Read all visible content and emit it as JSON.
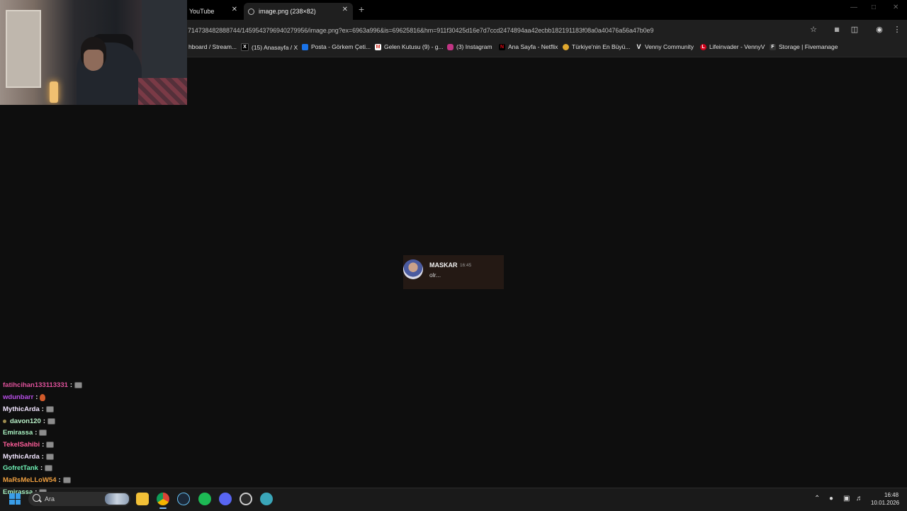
{
  "browser": {
    "tabs": [
      {
        "label": "YouTube"
      },
      {
        "label": "image.png (238×82)"
      }
    ],
    "new_tab_symbol": "+",
    "close_symbol": "✕",
    "url": "714738482888744/1459543796940279956/image.png?ex=6963a996&is=69625816&hm=911f30425d16e7d7ccd2474894aa42ecbb182191183f08a0a40476a56a47b0e9",
    "bookmarks": [
      {
        "label": "hboard / Stream...",
        "icon": "stream-icon",
        "color": "#1f1f1f"
      },
      {
        "label": "(15) Anasayfa / X",
        "icon": "x-icon",
        "color": "#000000"
      },
      {
        "label": "Posta - Görkem Çeti...",
        "icon": "outlook-icon",
        "color": "#1a73e8"
      },
      {
        "label": "Gelen Kutusu (9) - g...",
        "icon": "gmail-icon",
        "color": "#d93025"
      },
      {
        "label": "(3) Instagram",
        "icon": "instagram-icon",
        "color": "#c13584"
      },
      {
        "label": "Ana Sayfa - Netflix",
        "icon": "netflix-icon",
        "color": "#e50914"
      },
      {
        "label": "Türkiye'nin En Büyü...",
        "icon": "site-icon",
        "color": "#e0a82e"
      },
      {
        "label": "Venny Community",
        "icon": "venny-icon",
        "color": "#444444"
      },
      {
        "label": "Lifeinvader - VennyV",
        "icon": "lifeinvader-icon",
        "color": "#d0021b"
      },
      {
        "label": "Storage | Fivemanage",
        "icon": "fivemanage-icon",
        "color": "#333333"
      }
    ]
  },
  "viewer": {
    "message": {
      "username": "MASKAR",
      "time": "16:45",
      "text": "olr..."
    }
  },
  "chat": [
    {
      "user": "fatihcihan133113331",
      "color": "#e0529c",
      "emote": "emote"
    },
    {
      "user": "wdunbarr",
      "color": "#b84ee8",
      "emote": "fire"
    },
    {
      "user": "MythicArda",
      "color": "#f2e6ff",
      "emote": "emote"
    },
    {
      "user": "davon120",
      "color": "#b9f0c8",
      "emote": "emote",
      "badge": true
    },
    {
      "user": "Emirassa",
      "color": "#a8f0c0",
      "emote": "emote"
    },
    {
      "user": "TekelSahibi",
      "color": "#ff5e9a",
      "emote": "emote"
    },
    {
      "user": "MythicArda",
      "color": "#f2e6ff",
      "emote": "emote"
    },
    {
      "user": "GofretTank",
      "color": "#6ef0b4",
      "emote": "emote"
    },
    {
      "user": "MaRsMeLLoW54",
      "color": "#f0a040",
      "emote": "emote"
    },
    {
      "user": "Emirassa",
      "color": "#a8f0c0",
      "emote": "emote"
    }
  ],
  "chat_separator": ":",
  "taskbar": {
    "search_placeholder": "Ara",
    "apps": [
      "file-explorer-icon",
      "chrome-icon",
      "steam-icon",
      "spotify-icon",
      "discord-icon",
      "obs-icon",
      "browser-icon"
    ],
    "clock_time": "16:48",
    "clock_date": "10.01.2026"
  }
}
